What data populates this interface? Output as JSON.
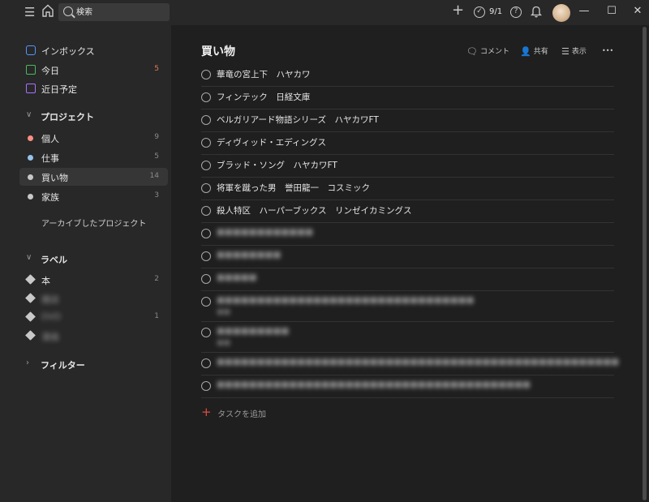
{
  "topbar": {
    "search_placeholder": "検索",
    "karma": "9/1",
    "menu_icon": "☰",
    "add_icon": "+",
    "bell_icon": "🔔",
    "help_icon": "?"
  },
  "window": {
    "minimize": "—",
    "maximize": "☐",
    "close": "✕"
  },
  "sidebar": {
    "nav": [
      {
        "label": "インボックス",
        "count": ""
      },
      {
        "label": "今日",
        "count": "5"
      },
      {
        "label": "近日予定",
        "count": ""
      }
    ],
    "projects_header": "プロジェクト",
    "projects": [
      {
        "label": "個人",
        "count": "9",
        "color": "#ff8d85"
      },
      {
        "label": "仕事",
        "count": "5",
        "color": "#96c3eb"
      },
      {
        "label": "買い物",
        "count": "14",
        "color": "#c8c8c8"
      },
      {
        "label": "家族",
        "count": "3",
        "color": "#c8c8c8"
      }
    ],
    "archived_label": "アーカイブしたプロジェクト",
    "labels_header": "ラベル",
    "labels": [
      {
        "label": "本",
        "count": "2"
      },
      {
        "label": "雑誌",
        "count": ""
      },
      {
        "label": "DVD",
        "count": "1"
      },
      {
        "label": "漫画",
        "count": ""
      }
    ],
    "filters_header": "フィルター"
  },
  "main": {
    "title": "買い物",
    "actions": {
      "comment": "コメント",
      "share": "共有",
      "view": "表示",
      "more": "•••"
    },
    "tasks": [
      {
        "text": "華竜の宮上下　ハヤカワ",
        "sub": ""
      },
      {
        "text": "フィンテック　日経文庫",
        "sub": ""
      },
      {
        "text": "ベルガリアード物語シリーズ　ハヤカワFT",
        "sub": ""
      },
      {
        "text": "ディヴィッド・エディングス",
        "sub": ""
      },
      {
        "text": "ブラッド・ソング　ハヤカワFT",
        "sub": ""
      },
      {
        "text": "将軍を蹴った男　誉田龍一　コスミック",
        "sub": ""
      },
      {
        "text": "殺人特区　ハーパーブックス　リンゼイカミングス",
        "sub": ""
      },
      {
        "text": "■■■■■■■■■■■■",
        "sub": ""
      },
      {
        "text": "■■■■■■■■",
        "sub": ""
      },
      {
        "text": "■■■■■",
        "sub": ""
      },
      {
        "text": "■■■■■■■■■■■■■■■■■■■■■■■■■■■■■■■■",
        "sub": "■■"
      },
      {
        "text": "■■■■■■■■■",
        "sub": "■■"
      },
      {
        "text": "■■■■■■■■■■■■■■■■■■■■■■■■■■■■■■■■■■■■■■■■■■■■■■■■■■",
        "sub": ""
      },
      {
        "text": "■■■■■■■■■■■■■■■■■■■■■■■■■■■■■■■■■■■■■■■",
        "sub": ""
      }
    ],
    "add_task": "タスクを追加"
  }
}
